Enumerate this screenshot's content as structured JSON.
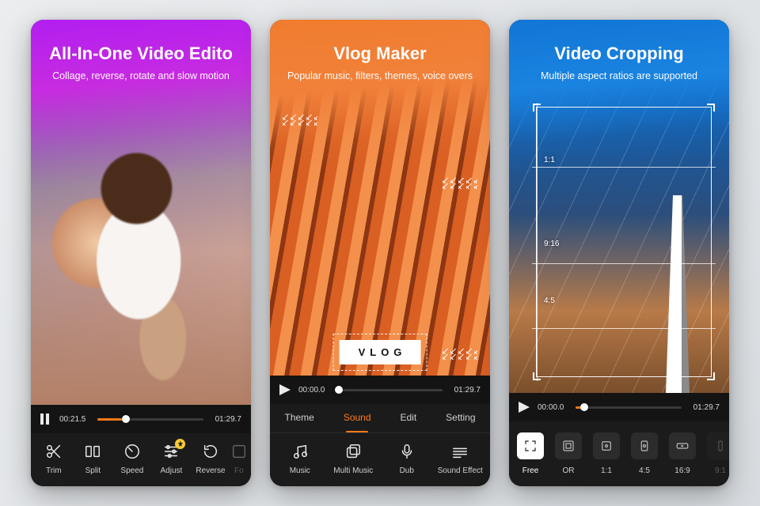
{
  "panels": {
    "editor": {
      "title": "All-In-One Video Edito",
      "subtitle": "Collage, reverse, rotate and slow motion",
      "playbar": {
        "state": "paused",
        "current": "00:21.5",
        "total": "01:29.7",
        "progress_pct": 27
      },
      "tools": [
        {
          "id": "trim",
          "label": "Trim",
          "icon": "scissors-icon"
        },
        {
          "id": "split",
          "label": "Split",
          "icon": "split-icon"
        },
        {
          "id": "speed",
          "label": "Speed",
          "icon": "speed-icon"
        },
        {
          "id": "adjust",
          "label": "Adjust",
          "icon": "sliders-icon",
          "premium": true
        },
        {
          "id": "reverse",
          "label": "Reverse",
          "icon": "reverse-icon"
        },
        {
          "id": "more",
          "label": "Fo",
          "icon": "more-icon",
          "faded": true
        }
      ]
    },
    "vlog": {
      "title": "Vlog Maker",
      "subtitle": "Popular music, filters, themes, voice overs",
      "badge": "VLOG",
      "playbar": {
        "state": "playing",
        "current": "00:00.0",
        "total": "01:29.7",
        "progress_pct": 2
      },
      "tabs": [
        {
          "label": "Theme",
          "active": false
        },
        {
          "label": "Sound",
          "active": true
        },
        {
          "label": "Edit",
          "active": false
        },
        {
          "label": "Setting",
          "active": false
        }
      ],
      "tools": [
        {
          "id": "music",
          "label": "Music",
          "icon": "music-icon"
        },
        {
          "id": "multi-music",
          "label": "Multi Music",
          "icon": "multi-music-icon"
        },
        {
          "id": "dub",
          "label": "Dub",
          "icon": "mic-icon"
        },
        {
          "id": "sound-effect",
          "label": "Sound Effect",
          "icon": "sound-effect-icon"
        }
      ]
    },
    "crop": {
      "title": "Video Cropping",
      "subtitle": "Multiple aspect ratios are supported",
      "overlay_ratios": {
        "r11": "1:1",
        "r916": "9:16",
        "r45": "4:5"
      },
      "playbar": {
        "state": "playing",
        "current": "00:00.0",
        "total": "01:29.7",
        "progress_pct": 8
      },
      "ratios": [
        {
          "id": "free",
          "label": "Free",
          "icon": "crop-free-icon",
          "selected": true
        },
        {
          "id": "or",
          "label": "OR",
          "icon": "original-icon"
        },
        {
          "id": "11",
          "label": "1:1",
          "icon": "square-icon"
        },
        {
          "id": "45",
          "label": "4:5",
          "icon": "portrait-icon"
        },
        {
          "id": "169",
          "label": "16:9",
          "icon": "wide-icon"
        },
        {
          "id": "916",
          "label": "9:1",
          "icon": "tall-icon",
          "faded": true
        }
      ]
    }
  },
  "colors": {
    "accent": "#ff7b1a",
    "panel_bg": "#1b1b1b"
  }
}
